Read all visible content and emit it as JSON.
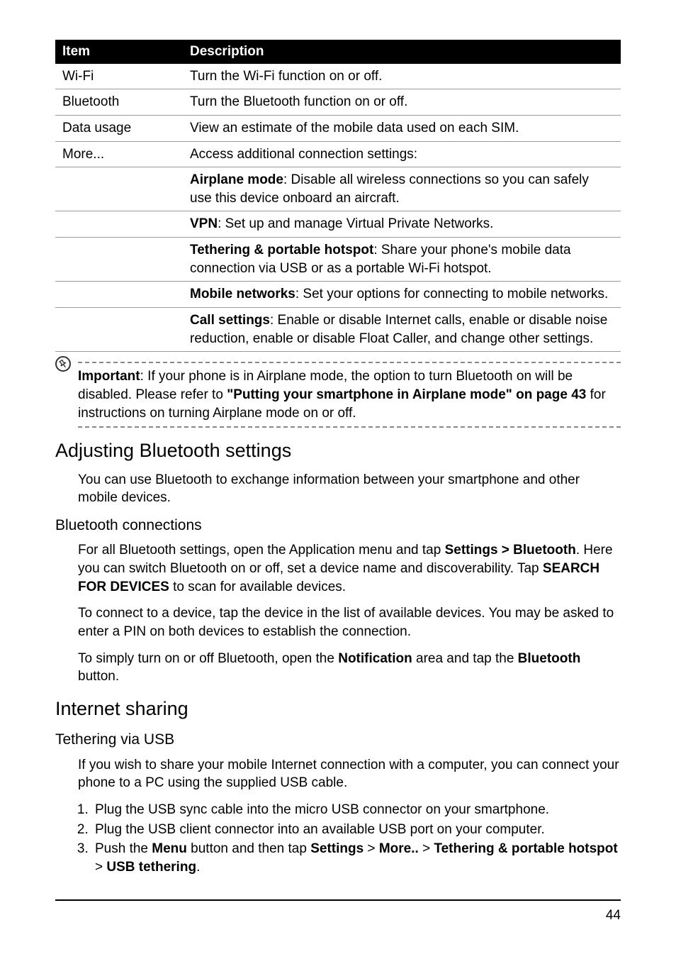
{
  "table": {
    "headers": {
      "item": "Item",
      "desc": "Description"
    },
    "rows": [
      {
        "item": "Wi-Fi",
        "desc": "Turn the Wi-Fi function on or off."
      },
      {
        "item": "Bluetooth",
        "desc": "Turn the Bluetooth function on or off."
      },
      {
        "item": "Data usage",
        "desc": "View an estimate of the mobile data used on each SIM."
      },
      {
        "item": "More...",
        "desc": "Access additional connection settings:"
      }
    ],
    "more": {
      "airplane_label": "Airplane mode",
      "airplane_text": ": Disable all wireless connections so you can safely use this device onboard an aircraft.",
      "vpn_label": "VPN",
      "vpn_text": ": Set up and manage Virtual Private Networks.",
      "tether_label": "Tethering & portable hotspot",
      "tether_text": ": Share your phone's mobile data connection via USB or as a portable Wi-Fi hotspot.",
      "mobile_label": "Mobile networks",
      "mobile_text": ": Set your options for connecting to mobile networks.",
      "call_label": "Call settings",
      "call_text": ": Enable or disable Internet calls, enable or disable noise reduction, enable or disable Float Caller, and change other settings."
    }
  },
  "note": {
    "important": "Important",
    "text1": ": If your phone is in Airplane mode, the option to turn Bluetooth on will be disabled. Please refer to ",
    "ref": "\"Putting your smartphone in Airplane mode\" on page 43",
    "text2": " for instructions on turning Airplane mode on or off."
  },
  "sections": {
    "bt_heading": "Adjusting Bluetooth settings",
    "bt_intro": "You can use Bluetooth to exchange information between your smartphone and other mobile devices.",
    "btc_heading": "Bluetooth connections",
    "btc_p1_a": "For all Bluetooth settings, open the Application menu and tap ",
    "btc_p1_b": "Settings > Bluetooth",
    "btc_p1_c": ". Here you can switch Bluetooth on or off, set a device name and discoverability. Tap ",
    "btc_p1_d": "SEARCH FOR DEVICES",
    "btc_p1_e": " to scan for available devices.",
    "btc_p2": "To connect to a device, tap the device in the list of available devices. You may be asked to enter a PIN on both devices to establish the connection.",
    "btc_p3_a": "To simply turn on or off Bluetooth, open the ",
    "btc_p3_b": "Notification",
    "btc_p3_c": " area and tap the ",
    "btc_p3_d": "Bluetooth",
    "btc_p3_e": " button.",
    "is_heading": "Internet sharing",
    "usb_heading": "Tethering via USB",
    "usb_intro": "If you wish to share your mobile Internet connection with a computer, you can connect your phone to a PC using the supplied USB cable.",
    "ol1": "Plug the USB sync cable into the micro USB connector on your smartphone.",
    "ol2": "Plug the USB client connector into an available USB port on your computer.",
    "ol3_a": "Push the ",
    "ol3_b": "Menu",
    "ol3_c": " button and then tap ",
    "ol3_d": "Settings",
    "ol3_e": " > ",
    "ol3_f": "More..",
    "ol3_g": " > ",
    "ol3_h": "Tethering & portable hotspot",
    "ol3_i": " > ",
    "ol3_j": "USB tethering",
    "ol3_k": "."
  },
  "page_number": "44"
}
